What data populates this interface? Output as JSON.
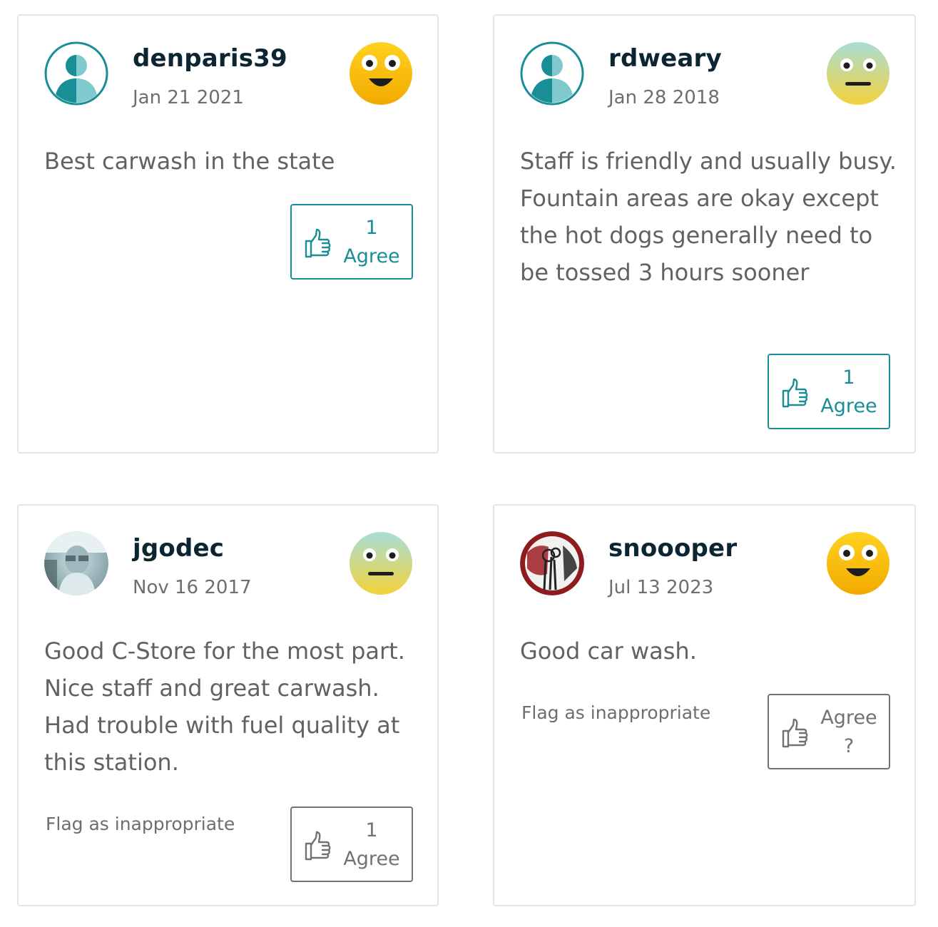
{
  "reviews": [
    {
      "username": "denparis39",
      "date": "Jan 21 2021",
      "rating_face": "happy-face-icon",
      "text": "Best carwash in the state",
      "flag_label": "",
      "agree_count": "1",
      "agree_label": "Agree"
    },
    {
      "username": "rdweary",
      "date": "Jan 28 2018",
      "rating_face": "neutral-face-icon",
      "text": "Staff is friendly and usually busy. Fountain areas are okay except the hot dogs generally need to be tossed 3 hours sooner",
      "flag_label": "",
      "agree_count": "1",
      "agree_label": "Agree"
    },
    {
      "username": "jgodec",
      "date": "Nov 16 2017",
      "rating_face": "neutral-face-icon",
      "text": "Good C-Store for the most part. Nice staff and great carwash. Had trouble with fuel quality at this station.",
      "flag_label": "Flag as inappropriate",
      "agree_count": "1",
      "agree_label": "Agree"
    },
    {
      "username": "snoooper",
      "date": "Jul 13 2023",
      "rating_face": "happy-face-icon",
      "text": "Good car wash.",
      "flag_label": "Flag as inappropriate",
      "agree_label": "Agree",
      "agree_count": "?"
    }
  ],
  "colors": {
    "accent": "#1a8e96",
    "username": "#0b2533",
    "body_text": "#5f6366",
    "muted_text": "#6b6f72",
    "card_border": "#e3e5e7"
  }
}
